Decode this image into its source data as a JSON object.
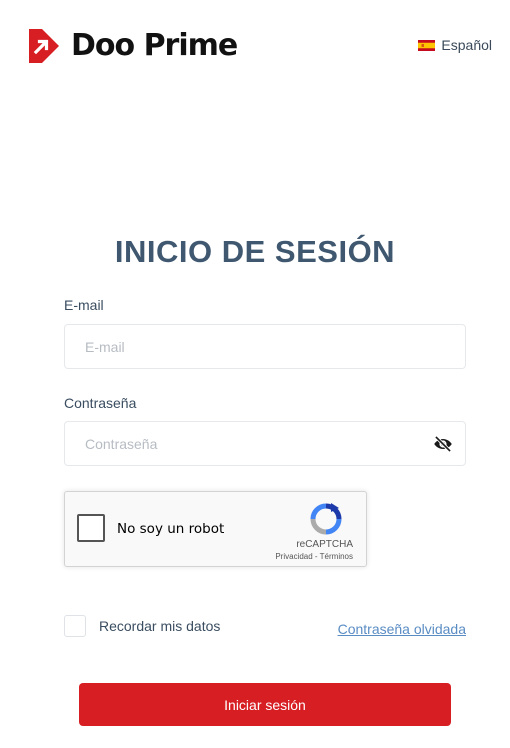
{
  "brand": {
    "name": "Doo Prime",
    "accent_color": "#d71e23",
    "logo_icon": "doo-prime-logo-icon"
  },
  "language": {
    "label": "Español",
    "flag_icon": "spain-flag-icon"
  },
  "form": {
    "title": "INICIO DE SESIÓN",
    "email": {
      "label": "E-mail",
      "placeholder": "E-mail",
      "value": ""
    },
    "password": {
      "label": "Contraseña",
      "placeholder": "Contraseña",
      "value": "",
      "toggle_icon": "eye-slash-icon"
    },
    "captcha": {
      "checkbox_label": "No soy un robot",
      "brand": "reCAPTCHA",
      "links": "Privacidad - Términos",
      "checked": false
    },
    "remember": {
      "label": "Recordar mis datos",
      "checked": false
    },
    "forgot_link": "Contraseña olvidada",
    "submit_label": "Iniciar sesión"
  }
}
